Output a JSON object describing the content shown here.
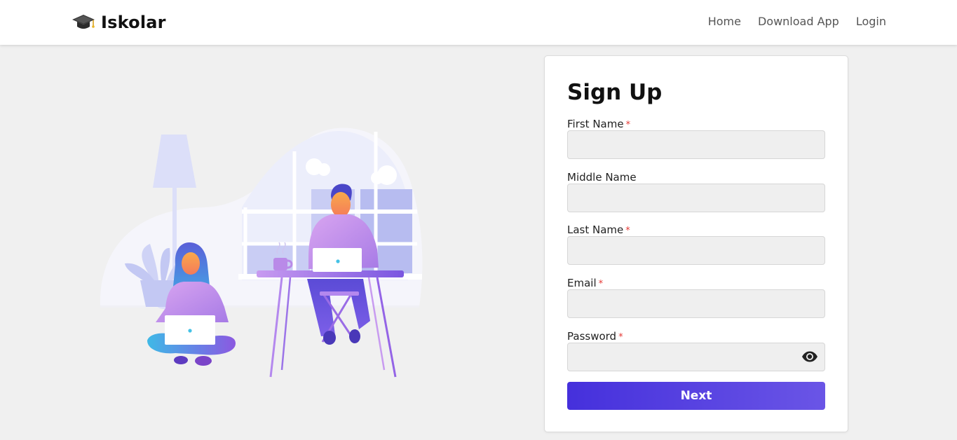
{
  "brand": {
    "name": "Iskolar",
    "icon": "graduation-cap-icon"
  },
  "nav": {
    "links": [
      {
        "label": "Home"
      },
      {
        "label": "Download App"
      },
      {
        "label": "Login"
      }
    ]
  },
  "illustration": {
    "name": "people-working-on-laptops-illustration"
  },
  "form": {
    "title": "Sign Up",
    "required_marker": "*",
    "fields": {
      "first_name": {
        "label": "First Name",
        "value": "",
        "required": true
      },
      "middle_name": {
        "label": "Middle Name",
        "value": "",
        "required": false
      },
      "last_name": {
        "label": "Last Name",
        "value": "",
        "required": true
      },
      "email": {
        "label": "Email",
        "value": "",
        "required": true
      },
      "password": {
        "label": "Password",
        "value": "",
        "required": true,
        "toggle_icon": "eye-icon"
      }
    },
    "submit_label": "Next"
  },
  "colors": {
    "page_background": "#f0f0f0",
    "primary_button_start": "#4530dc",
    "primary_button_end": "#6a55e6",
    "required_marker": "#e53935",
    "input_background": "#efefef"
  }
}
